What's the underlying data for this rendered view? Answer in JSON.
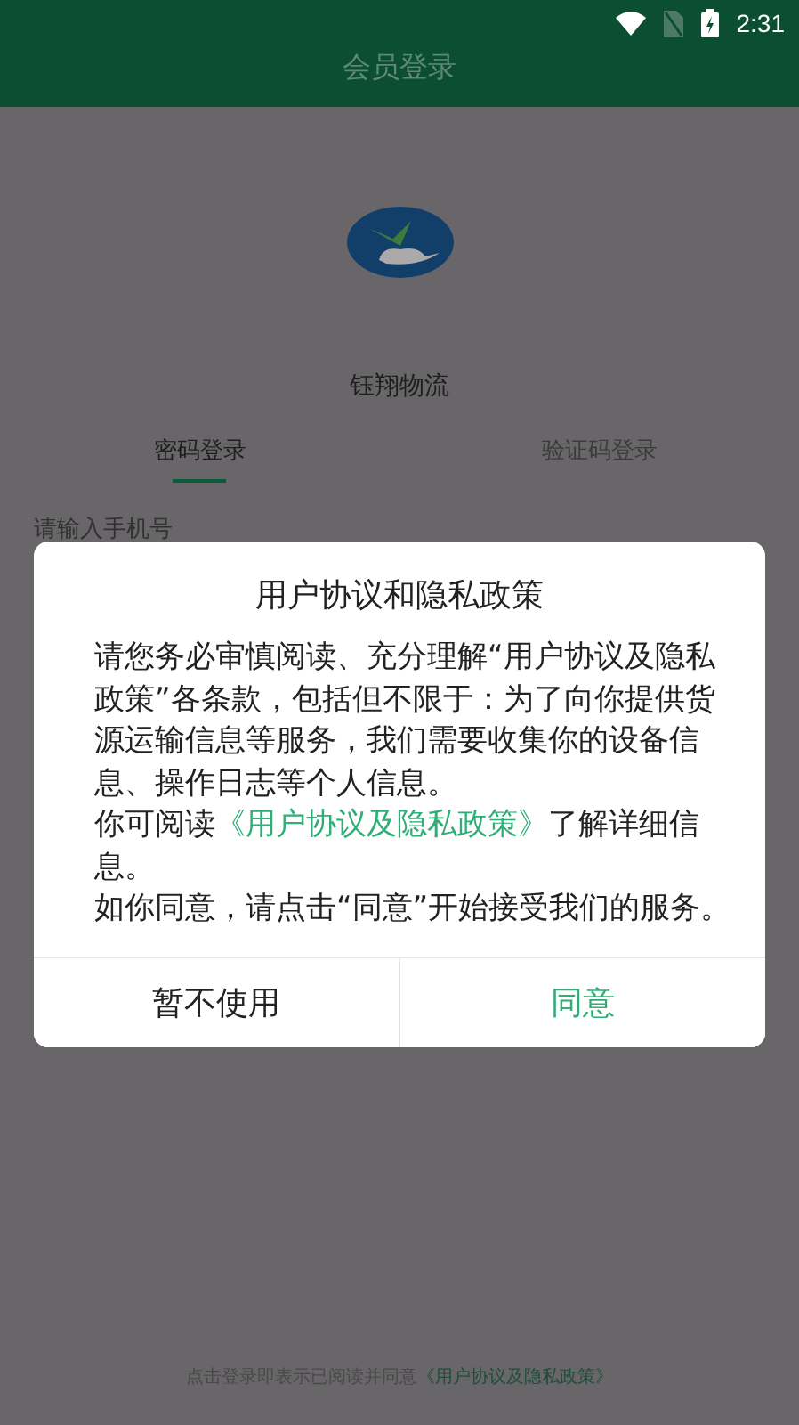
{
  "status_bar": {
    "time": "2:31"
  },
  "header": {
    "title": "会员登录"
  },
  "brand": {
    "name": "钰翔物流"
  },
  "tabs": [
    {
      "label": "密码登录",
      "selected": true
    },
    {
      "label": "验证码登录",
      "selected": false
    }
  ],
  "phone_field": {
    "placeholder": "请输入手机号"
  },
  "dialog": {
    "title": "用户协议和隐私政策",
    "intro": "请您务必审慎阅读、充分理解“用户协议及隐私政策”各条款，包括但不限于：为了向你提供货源运输信息等服务，我们需要收集你的设备信息、操作日志等个人信息。",
    "read_before": "你可阅读",
    "read_link": "《用户协议及隐私政策》",
    "read_after": "了解详细信息。",
    "consent": "如你同意，请点击“同意”开始接受我们的服务。",
    "decline_button": "暂不使用",
    "agree_button": "同意"
  },
  "footer": {
    "text": "点击登录即表示已阅读并同意",
    "link": "《用户协议及隐私政策》"
  }
}
